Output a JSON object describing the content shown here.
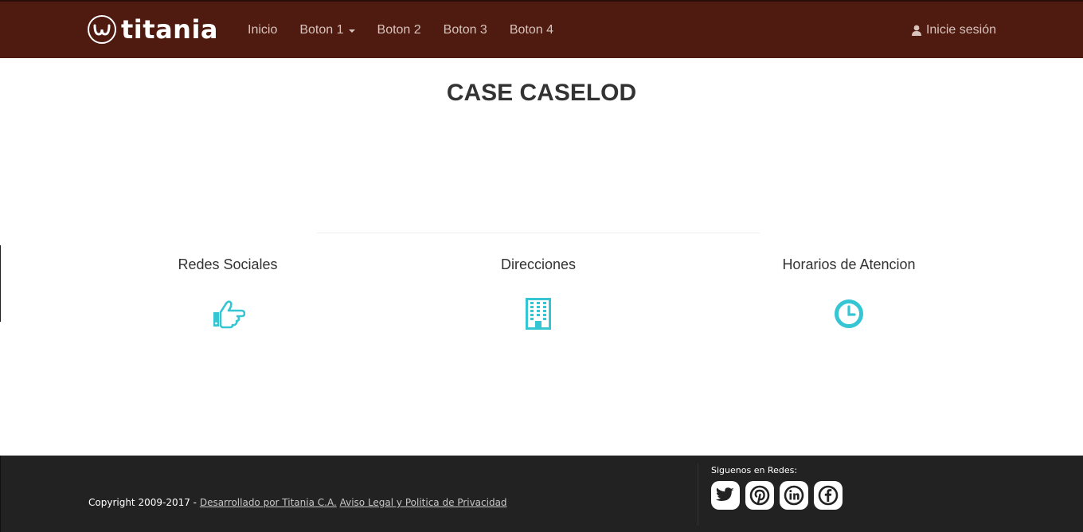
{
  "brand": {
    "name": "titania"
  },
  "nav": {
    "items": [
      {
        "label": "Inicio"
      },
      {
        "label": "Boton 1"
      },
      {
        "label": "Boton 2"
      },
      {
        "label": "Boton 3"
      },
      {
        "label": "Boton 4"
      }
    ],
    "login_label": "Inicie sesión"
  },
  "main": {
    "title": "CASE CASELOD",
    "columns": [
      {
        "heading": "Redes Sociales",
        "icon": "hand-pointing-icon"
      },
      {
        "heading": "Direcciones",
        "icon": "building-icon"
      },
      {
        "heading": "Horarios de Atencion",
        "icon": "clock-icon"
      }
    ]
  },
  "footer": {
    "copyright": "Copyright 2009-2017 - ",
    "link_developer": "Desarrollado por Titania C.A.",
    "link_legal": "Aviso Legal y Politica de Privacidad",
    "social_title": "Siguenos en Redes:",
    "social": [
      "twitter-icon",
      "pinterest-icon",
      "linkedin-icon",
      "facebook-icon"
    ]
  },
  "colors": {
    "navbar": "#4f1a10",
    "accent": "#36c6d3",
    "footer": "#222222"
  }
}
